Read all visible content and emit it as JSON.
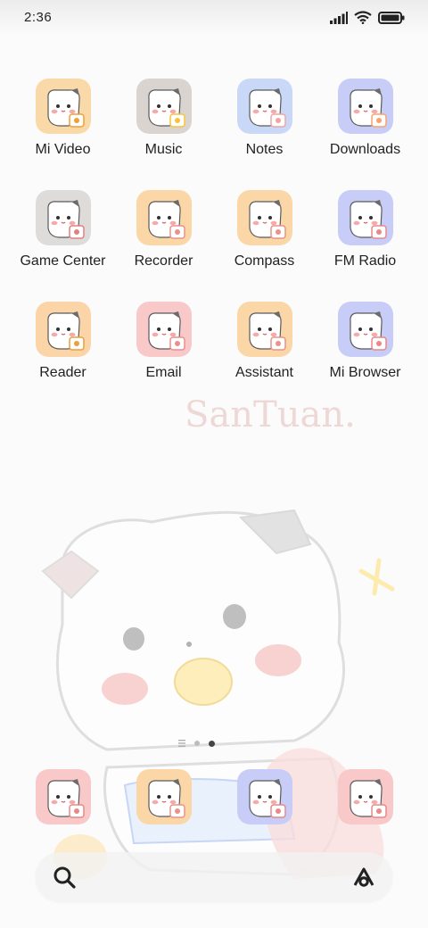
{
  "status_bar": {
    "time": "2:36"
  },
  "wallpaper": {
    "signature": "SanTuan."
  },
  "apps": [
    {
      "label": "Mi Video",
      "bg": "#f9d9a8",
      "accent": "#f0a030"
    },
    {
      "label": "Music",
      "bg": "#d9d4d0",
      "accent": "#f7c33a"
    },
    {
      "label": "Notes",
      "bg": "#c9d8f7",
      "accent": "#f3a2a2"
    },
    {
      "label": "Downloads",
      "bg": "#c8cdf7",
      "accent": "#f7a36a"
    },
    {
      "label": "Game Center",
      "bg": "#dedbdb",
      "accent": "#e37f7f"
    },
    {
      "label": "Recorder",
      "bg": "#fbd6a6",
      "accent": "#e9928a"
    },
    {
      "label": "Compass",
      "bg": "#fbd6a6",
      "accent": "#e9928a"
    },
    {
      "label": "FM Radio",
      "bg": "#c7cdf6",
      "accent": "#e88888"
    },
    {
      "label": "Reader",
      "bg": "#fbd5a8",
      "accent": "#e8a13b"
    },
    {
      "label": "Email",
      "bg": "#f9c8c8",
      "accent": "#e88f8f"
    },
    {
      "label": "Assistant",
      "bg": "#fbd6a6",
      "accent": "#e9928a"
    },
    {
      "label": "Mi Browser",
      "bg": "#c7cdf6",
      "accent": "#e88888"
    }
  ],
  "dock": [
    {
      "bg": "#f9c8c8",
      "accent": "#e88888"
    },
    {
      "bg": "#fbd6a6",
      "accent": "#e9928a"
    },
    {
      "bg": "#c7cdf6",
      "accent": "#e88888"
    },
    {
      "bg": "#f9c8c8",
      "accent": "#e88888"
    }
  ],
  "page_indicator": {
    "pages": 2,
    "current": 2
  },
  "search": {
    "left_icon": "search-icon",
    "right_icon": "assistant-icon"
  }
}
